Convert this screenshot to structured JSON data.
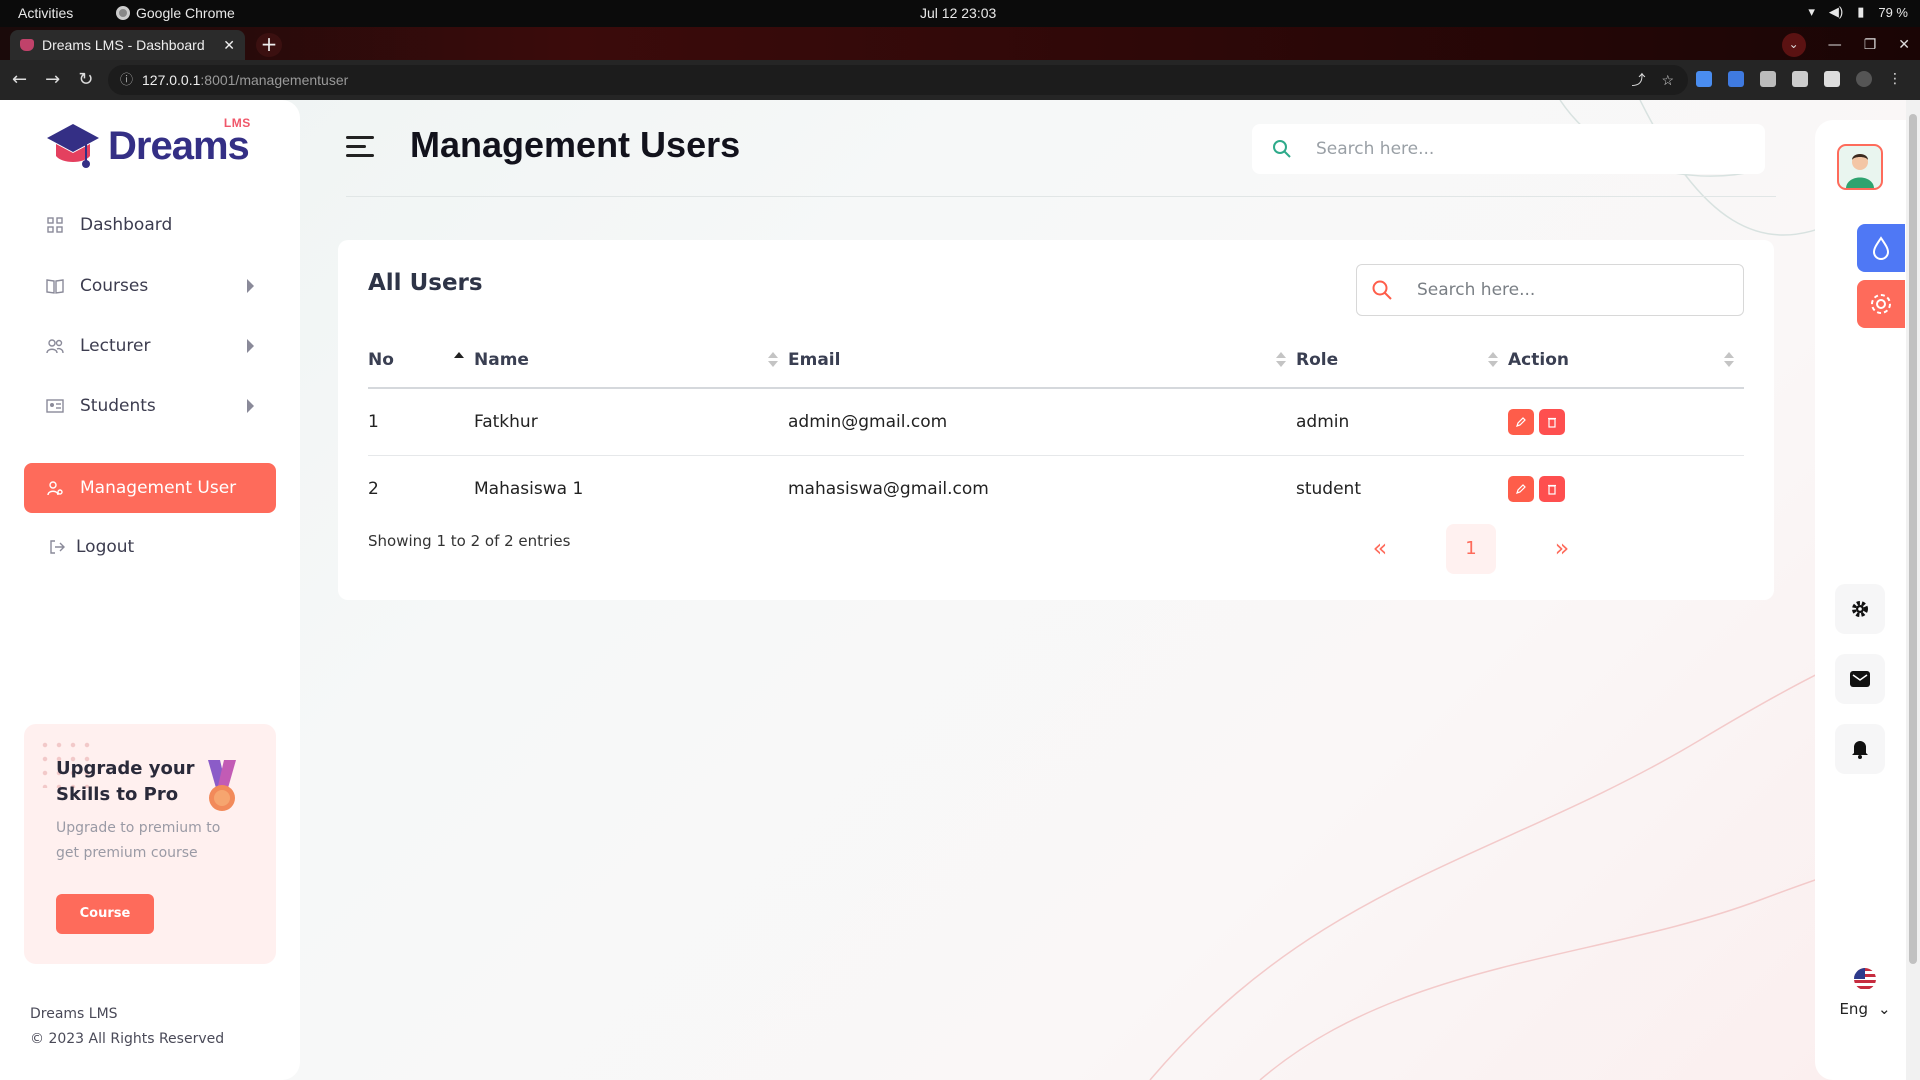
{
  "os": {
    "activities": "Activities",
    "app_name": "Google Chrome",
    "datetime": "Jul 12  23:03",
    "battery": "79 %"
  },
  "browser": {
    "tab_title": "Dreams LMS - Dashboard",
    "url_host": "127.0.0.1",
    "url_rest": ":8001/managementuser"
  },
  "sidebar": {
    "logo_text": "Dreams",
    "logo_badge": "LMS",
    "items": [
      {
        "label": "Dashboard",
        "icon": "grid-icon"
      },
      {
        "label": "Courses",
        "icon": "book-icon"
      },
      {
        "label": "Lecturer",
        "icon": "users-icon"
      },
      {
        "label": "Students",
        "icon": "id-card-icon"
      },
      {
        "label": "Management User",
        "icon": "user-icon"
      },
      {
        "label": "Logout",
        "icon": "logout-icon"
      }
    ],
    "upgrade": {
      "title": "Upgrade your Skills to Pro",
      "desc": "Upgrade to premium to get premium course",
      "button": "Course"
    },
    "footer_brand": "Dreams LMS",
    "footer_copy": "© 2023 All Rights Reserved"
  },
  "header": {
    "title": "Management Users",
    "search_placeholder": "Search here..."
  },
  "card": {
    "title": "All Users",
    "search_placeholder": "Search here...",
    "columns": [
      "No",
      "Name",
      "Email",
      "Role",
      "Action"
    ],
    "rows": [
      {
        "no": "1",
        "name": "Fatkhur",
        "email": "admin@gmail.com",
        "role": "admin"
      },
      {
        "no": "2",
        "name": "Mahasiswa 1",
        "email": "mahasiswa@gmail.com",
        "role": "student"
      }
    ],
    "entries_text": "Showing 1 to 2 of 2 entries",
    "current_page": "1",
    "prev_symbol": "«",
    "next_symbol": "»"
  },
  "right_rail": {
    "language": "Eng"
  },
  "colors": {
    "accent": "#fe6b5b",
    "brand": "#342f85",
    "blue": "#4f78f5"
  }
}
